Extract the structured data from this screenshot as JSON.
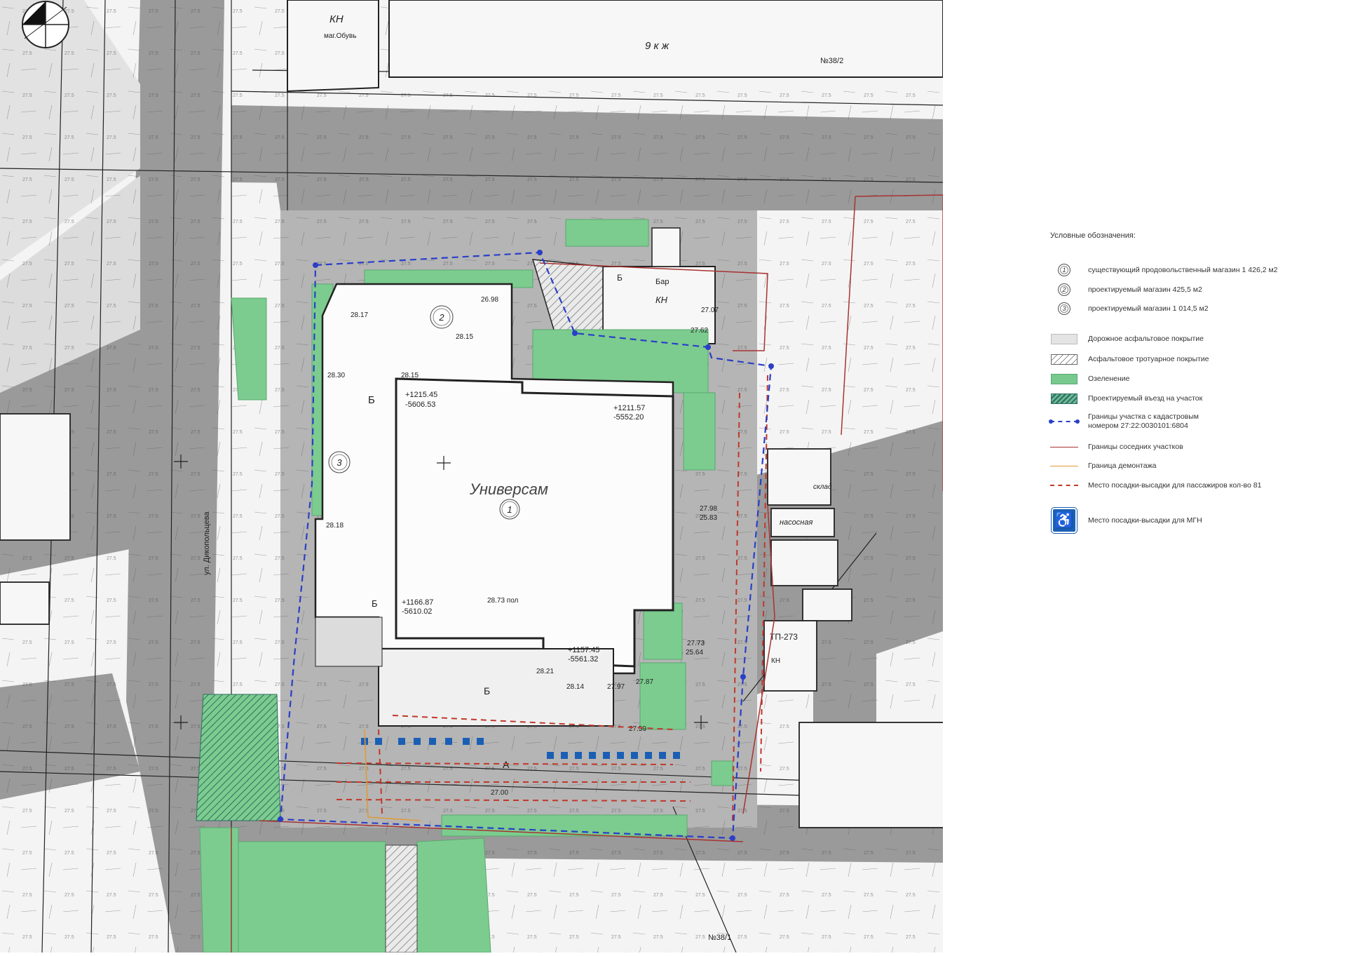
{
  "map": {
    "labels": {
      "universam": "Универсам",
      "b": "Б",
      "a": "А",
      "street": "ул. Дикопольцева",
      "bar": "Бар",
      "kn": "КН",
      "nasosnaya": "насосная",
      "sklad": "склад",
      "tp": "ТП-273",
      "obuv": "маг.Обувь",
      "kzh9": "9 к ж",
      "n38_2": "№38/2",
      "n38_1": "№38/1"
    },
    "markers": [
      "1",
      "2",
      "3"
    ],
    "elevations": [
      "26.98",
      "28.15",
      "28.30",
      "28.15",
      "27.98",
      "25.83",
      "28.73 пол",
      "27.73",
      "25.64",
      "27.00",
      "27.87",
      "27.62",
      "27.07",
      "27.59",
      "28.17",
      "28.21",
      "28.14",
      "27.97",
      "28.18"
    ],
    "coords": [
      "+1215.45",
      "-5606.53",
      "+1211.57",
      "-5552.20",
      "+1166.87",
      "-5610.02",
      "+1157.45",
      "-5561.32"
    ],
    "colors": {
      "road": "#9a9a9a",
      "green": "#7ccc8f",
      "plot_boundary": "#2a3fc7",
      "neighbor_boundary": "#a83232",
      "parking": "#c0392b"
    }
  },
  "legend": {
    "title": "Условные обозначения:",
    "items": [
      {
        "sym": "1",
        "text": "существующий продовольственный магазин 1 426,2 м2"
      },
      {
        "sym": "2",
        "text": "проектируемый магазин 425,5 м2"
      },
      {
        "sym": "3",
        "text": "проектируемый магазин 1 014,5 м2"
      },
      {
        "sym": "road",
        "text": "Дорожное асфальтовое покрытие"
      },
      {
        "sym": "walk",
        "text": "Асфальтовое тротуарное покрытие"
      },
      {
        "sym": "green",
        "text": "Озеленение"
      },
      {
        "sym": "entry",
        "text": "Проектируемый въезд на участок"
      },
      {
        "sym": "plot",
        "text": "Границы участка с кадастровым\nномером 27:22:0030101:6804"
      },
      {
        "sym": "neighbor",
        "text": "Границы соседних участков"
      },
      {
        "sym": "demolition",
        "text": "Граница демонтажа"
      },
      {
        "sym": "parking",
        "text": "Место посадки-высадки для пассажиров кол-во 81"
      },
      {
        "sym": "mgn",
        "text": "Место посадки-высадки для МГН"
      }
    ]
  }
}
